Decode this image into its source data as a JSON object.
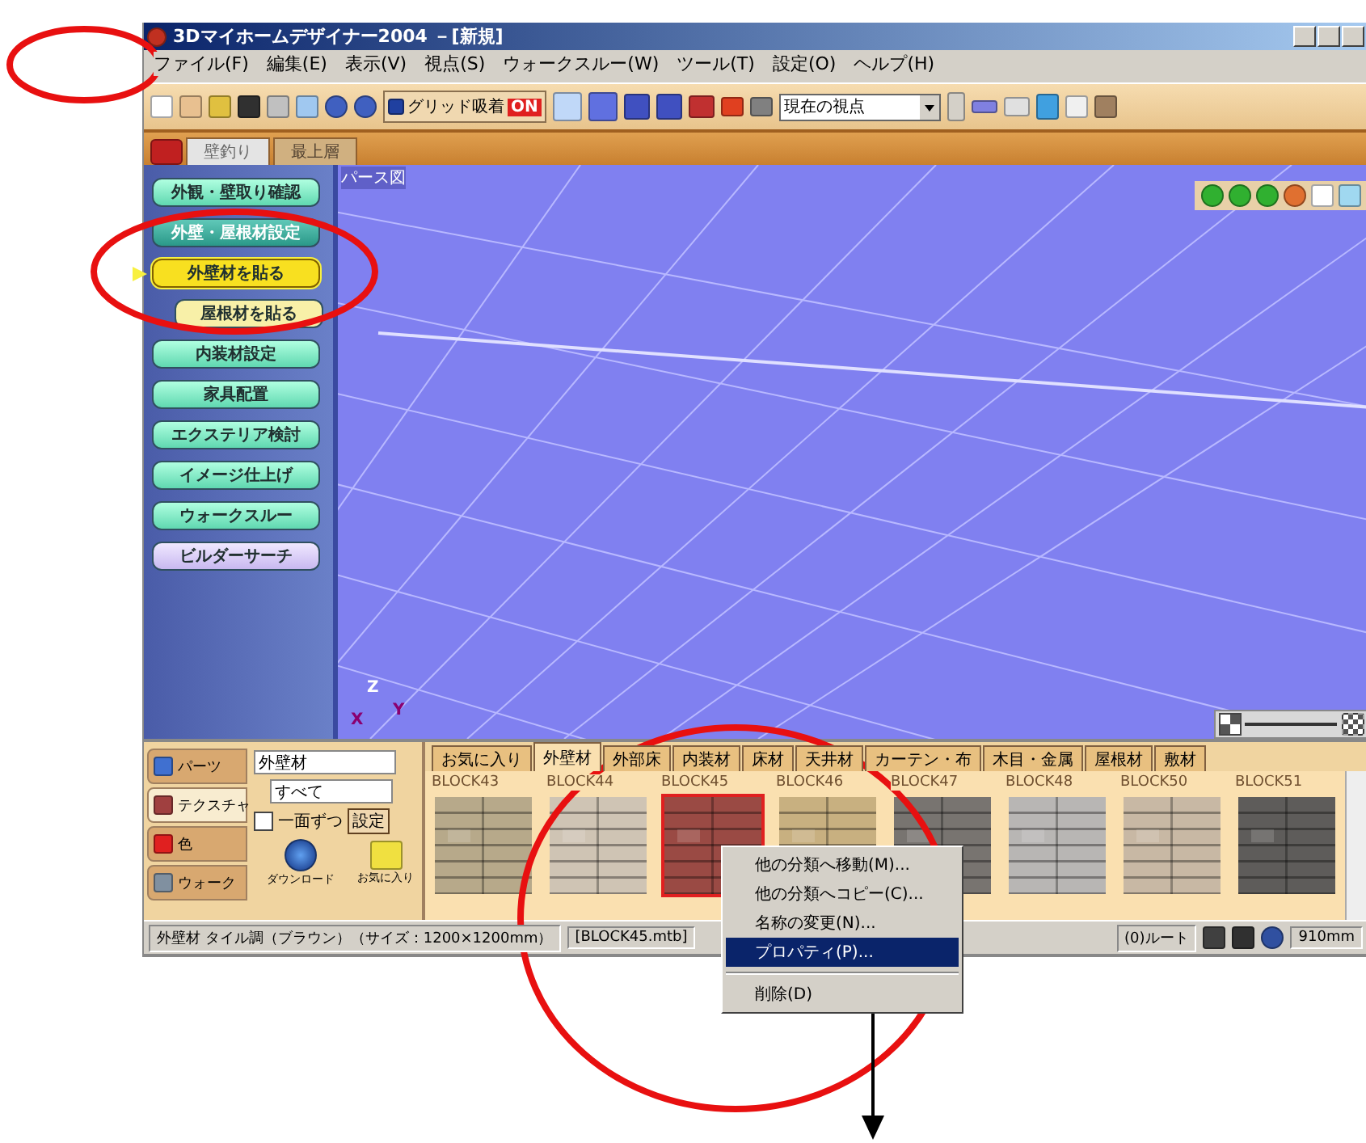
{
  "window": {
    "title": "3Dマイホームデザイナー2004 －[新規]"
  },
  "menu": [
    "ファイル(F)",
    "編集(E)",
    "表示(V)",
    "視点(S)",
    "ウォークスルー(W)",
    "ツール(T)",
    "設定(O)",
    "ヘルプ(H)"
  ],
  "toolbar": {
    "grid_snap": {
      "label": "グリッド吸着",
      "badge": "ON",
      "on": true
    },
    "viewpoint": {
      "value": "現在の視点"
    }
  },
  "layer_tabs": [
    {
      "label": "壁釣り",
      "disabled": true
    },
    {
      "label": "最上層",
      "disabled": false
    }
  ],
  "sidebar": {
    "items": [
      {
        "label": "外観・壁取り確認",
        "kind": "button",
        "selected": false
      },
      {
        "label": "外壁・屋根材設定",
        "kind": "group",
        "selected": false
      },
      {
        "label": "外壁材を貼る",
        "kind": "sub",
        "selected": true
      },
      {
        "label": "屋根材を貼る",
        "kind": "sub",
        "selected": false
      },
      {
        "label": "内装材設定",
        "kind": "button",
        "selected": false
      },
      {
        "label": "家具配置",
        "kind": "button",
        "selected": false
      },
      {
        "label": "エクステリア検討",
        "kind": "button",
        "selected": false
      },
      {
        "label": "イメージ仕上げ",
        "kind": "button",
        "selected": false
      },
      {
        "label": "ウォークスルー",
        "kind": "button",
        "selected": false
      },
      {
        "label": "ビルダーサーチ",
        "kind": "search",
        "selected": false
      }
    ]
  },
  "viewport": {
    "label": "パース図",
    "axes": [
      "Z",
      "X",
      "Y"
    ],
    "zoom_slider": {
      "level": 0.02
    }
  },
  "mode_tabs": [
    {
      "label": "パーツ",
      "selected": false
    },
    {
      "label": "テクスチャ",
      "selected": true
    },
    {
      "label": "色",
      "selected": false
    },
    {
      "label": "ウォーク",
      "selected": false
    }
  ],
  "filter": {
    "category": "外壁材",
    "subcategory": "すべて",
    "one_face": {
      "label": "一面ずつ",
      "checked": false
    },
    "apply": "設定",
    "download": "ダウンロード",
    "favorites": "お気に入り"
  },
  "material_tabs": [
    {
      "label": "お気に入り",
      "selected": false
    },
    {
      "label": "外壁材",
      "selected": true
    },
    {
      "label": "外部床",
      "selected": false
    },
    {
      "label": "内装材",
      "selected": false
    },
    {
      "label": "床材",
      "selected": false
    },
    {
      "label": "天井材",
      "selected": false
    },
    {
      "label": "カーテン・布",
      "selected": false
    },
    {
      "label": "木目・金属",
      "selected": false
    },
    {
      "label": "屋根材",
      "selected": false
    },
    {
      "label": "敷材",
      "selected": false
    }
  ],
  "materials": [
    {
      "name": "BLOCK43",
      "selected": false
    },
    {
      "name": "BLOCK44",
      "selected": false
    },
    {
      "name": "BLOCK45",
      "selected": true
    },
    {
      "name": "BLOCK46",
      "selected": false
    },
    {
      "name": "BLOCK47",
      "selected": false
    },
    {
      "name": "BLOCK48",
      "selected": false
    },
    {
      "name": "BLOCK50",
      "selected": false
    },
    {
      "name": "BLOCK51",
      "selected": false
    }
  ],
  "status_bar": {
    "description": "外壁材 タイル調（ブラウン）（サイズ：1200×1200mm）",
    "file": "[BLOCK45.mtb]",
    "layer": "(0)ルート",
    "scale": "910mm"
  },
  "context_menu": {
    "items": [
      {
        "label": "他の分類へ移動(M)...",
        "selected": false
      },
      {
        "label": "他の分類へコピー(C)...",
        "selected": false
      },
      {
        "label": "名称の変更(N)...",
        "selected": false
      },
      {
        "label": "プロパティ(P)...",
        "selected": true
      },
      {
        "label": "削除(D)",
        "selected": false,
        "separator_before": true
      }
    ]
  },
  "annotations": [
    {
      "kind": "ellipse"
    },
    {
      "kind": "ellipse"
    },
    {
      "kind": "ellipse"
    },
    {
      "kind": "arrow"
    }
  ]
}
